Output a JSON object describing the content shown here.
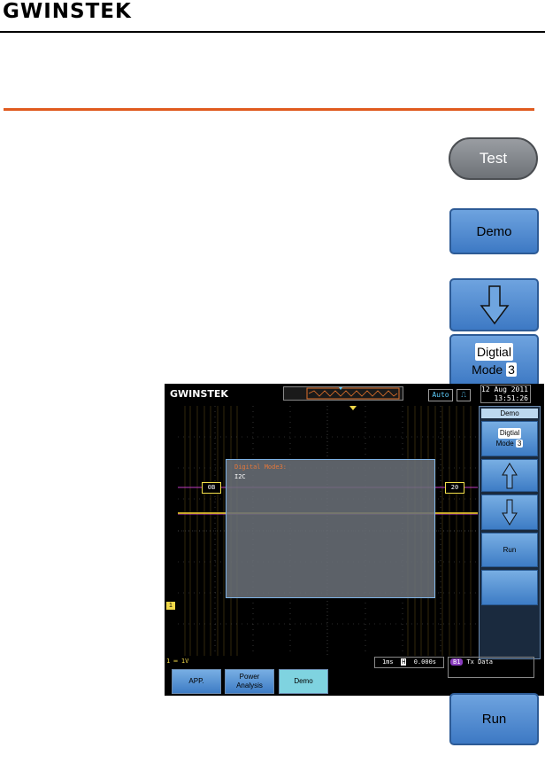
{
  "header": {
    "logo_text": "GWINSTEK"
  },
  "buttons": {
    "test": "Test",
    "demo": "Demo",
    "mode_word": "Digtial",
    "mode_label": "Mode",
    "mode_number": "3",
    "run": "Run"
  },
  "scope": {
    "logo_text": "GWINSTEK",
    "trigger_mode": "Auto",
    "date": "12 Aug 2011",
    "time": "13:51:26",
    "popup_title": "Digital Mode3:",
    "popup_line": "I2C",
    "bus_left": "0B",
    "bus_right": "20",
    "ch1_marker": "1",
    "status_left": "1 ═ 1V",
    "timebase": "1ms",
    "delay": "0.000s",
    "tx_tag": "B1",
    "tx_label": "Tx Data",
    "menu": {
      "title": "Demo",
      "mode_word": "Digtial",
      "mode_label": "Mode",
      "mode_number": "3",
      "run": "Run"
    },
    "bottom_tabs": [
      "APP.",
      "Power Analysis",
      "Demo"
    ]
  },
  "colors": {
    "orange_rule": "#e05a1e",
    "soft_button_blue": "#3d79c4",
    "active_tab": "#7fd3e0"
  }
}
